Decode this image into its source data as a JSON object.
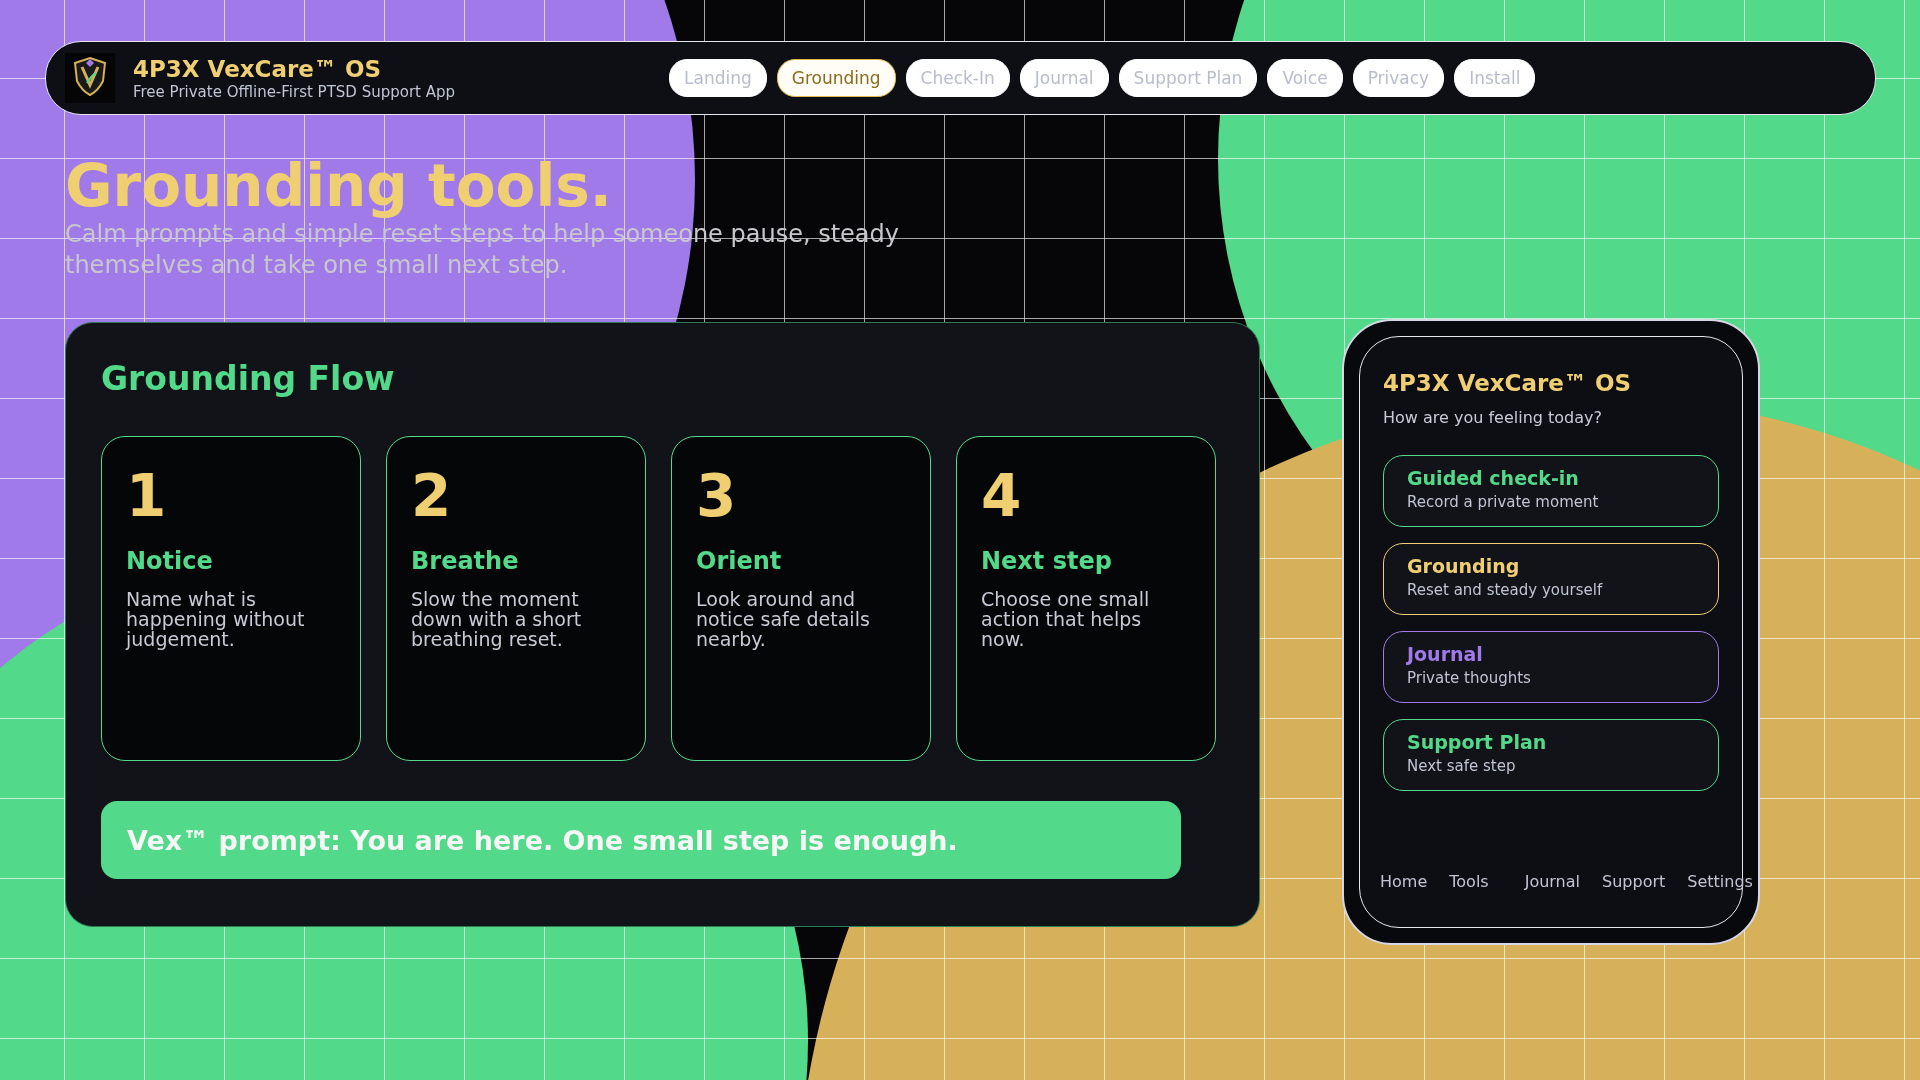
{
  "app": {
    "name": "4P3X VexCare™ OS",
    "tagline": "Free Private Offline-First PTSD Support App"
  },
  "nav": [
    {
      "label": "Landing",
      "selected": false
    },
    {
      "label": "Grounding",
      "selected": true
    },
    {
      "label": "Check-In",
      "selected": false
    },
    {
      "label": "Journal",
      "selected": false
    },
    {
      "label": "Support Plan",
      "selected": false
    },
    {
      "label": "Voice",
      "selected": false
    },
    {
      "label": "Privacy",
      "selected": false
    },
    {
      "label": "Install",
      "selected": false
    }
  ],
  "hero": {
    "title": "Grounding tools.",
    "subtitle": "Calm prompts and simple reset steps to help someone pause, steady themselves and take one small next step."
  },
  "flow": {
    "title": "Grounding Flow",
    "steps": [
      {
        "number": "1",
        "title": "Notice",
        "text": "Name what is happening without judgement."
      },
      {
        "number": "2",
        "title": "Breathe",
        "text": "Slow the moment down with a short breathing reset."
      },
      {
        "number": "3",
        "title": "Orient",
        "text": "Look around and notice safe details nearby."
      },
      {
        "number": "4",
        "title": "Next step",
        "text": "Choose one small action that helps now."
      }
    ],
    "prompt": "Vex™ prompt: You are here. One small step is enough."
  },
  "phone": {
    "title": "4P3X VexCare™ OS",
    "question": "How are you feeling today?",
    "items": [
      {
        "title": "Guided check-in",
        "subtitle": "Record a private moment",
        "color": "#53d98a"
      },
      {
        "title": "Grounding",
        "subtitle": "Reset and steady yourself",
        "color": "#f0cf73"
      },
      {
        "title": "Journal",
        "subtitle": "Private thoughts",
        "color": "#a07ae8"
      },
      {
        "title": "Support Plan",
        "subtitle": "Next safe step",
        "color": "#53d98a"
      }
    ],
    "tabs": [
      "Home",
      "Tools",
      "Journal",
      "Support",
      "Settings"
    ]
  }
}
